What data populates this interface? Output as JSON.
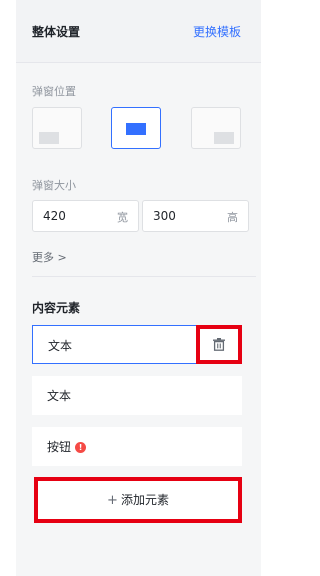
{
  "header": {
    "title": "整体设置",
    "change_template": "更换模板"
  },
  "popup_position": {
    "label": "弹窗位置",
    "options": [
      "left",
      "center",
      "right"
    ],
    "selected": "center"
  },
  "popup_size": {
    "label": "弹窗大小",
    "width_value": "420",
    "width_unit": "宽",
    "height_value": "300",
    "height_unit": "高"
  },
  "more_label": "更多 >",
  "content": {
    "title": "内容元素",
    "items": [
      {
        "label": "文本",
        "active": true,
        "warning": false
      },
      {
        "label": "文本",
        "active": false,
        "warning": false
      },
      {
        "label": "按钮",
        "active": false,
        "warning": true
      }
    ],
    "warning_glyph": "!",
    "delete_icon": "trash-icon",
    "add_label": "添加元素",
    "add_icon_glyph": "+"
  },
  "colors": {
    "accent": "#3370ff",
    "highlight": "#e60012",
    "warning": "#f54a45"
  }
}
